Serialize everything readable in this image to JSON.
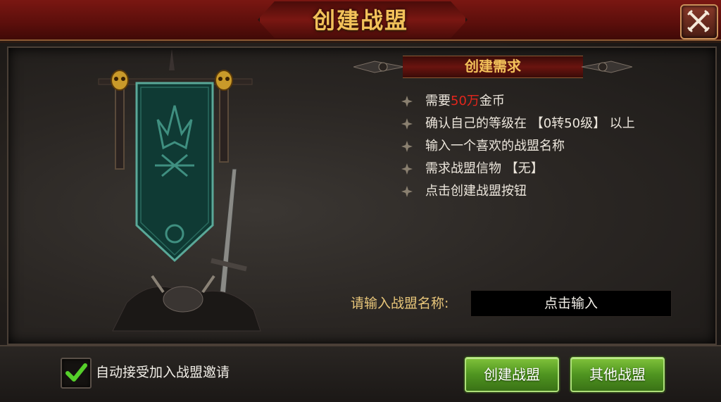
{
  "window": {
    "title": "创建战盟"
  },
  "requirements": {
    "header": "创建需求",
    "items": [
      {
        "parts": [
          {
            "text": "需要",
            "highlight": false
          },
          {
            "text": "50万",
            "highlight": true
          },
          {
            "text": "金币",
            "highlight": false
          }
        ]
      },
      {
        "parts": [
          {
            "text": "确认自己的等级在 【0转50级】 以上",
            "highlight": false
          }
        ]
      },
      {
        "parts": [
          {
            "text": "输入一个喜欢的战盟名称",
            "highlight": false
          }
        ]
      },
      {
        "parts": [
          {
            "text": "需求战盟信物 【无】",
            "highlight": false
          }
        ]
      },
      {
        "parts": [
          {
            "text": "点击创建战盟按钮",
            "highlight": false
          }
        ]
      }
    ]
  },
  "name_field": {
    "label": "请输入战盟名称:",
    "placeholder": "点击输入"
  },
  "auto_accept": {
    "label": "自动接受加入战盟邀请",
    "checked": true
  },
  "buttons": {
    "create": "创建战盟",
    "other": "其他战盟"
  },
  "colors": {
    "title_gold": "#f2c15a",
    "highlight_red": "#e3261c",
    "button_green": "#4f9420"
  }
}
